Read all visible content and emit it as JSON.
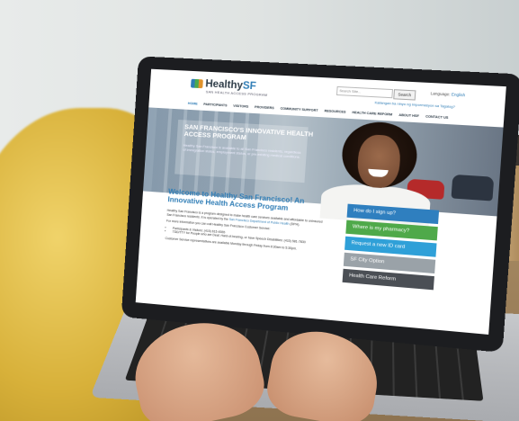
{
  "site": {
    "logo_prefix": "Healthy",
    "logo_suffix": "SF",
    "logo_tagline": "SAN HEALTH ACCESS PROGRAM",
    "search": {
      "placeholder": "Search Site...",
      "button": "Search"
    },
    "language_label": "Language:",
    "language_value": "English",
    "tagalog_link": "Kailangan ba ninyo ng impormasyon sa Tagalog?"
  },
  "nav": [
    "HOME",
    "PARTICIPANTS",
    "VISITORS",
    "PROVIDERS",
    "COMMUNITY SUPPORT",
    "RESOURCES",
    "HEALTH CARE REFORM",
    "ABOUT HSF",
    "CONTACT US"
  ],
  "hero": {
    "title": "SAN FRANCISCO'S INNOVATIVE HEALTH ACCESS PROGRAM",
    "text": "Healthy San Francisco is available to all San Francisco residents, regardless of immigration status, employment status, or pre-existing medical conditions."
  },
  "main": {
    "welcome": "Welcome to Healthy San Francisco! An Innovative Health Access Program",
    "p1": "Healthy San Francisco is a program designed to make health care services available and affordable to uninsured San Francisco residents. It is operated by the",
    "p1_link": "San Francisco Department of Public Health",
    "p1_end": "(DPH).",
    "more_info": "For more information you can call Healthy San Francisco Customer Service:",
    "bullet1": "Participants & Visitors: (415) 615-4555",
    "bullet2": "TDD/TTY for People who are Deaf, Hard-of-hearing, or have Speech Disabilities: (415) 581-7830",
    "hours": "Customer Service representatives are available Monday through Friday from 8:30am to 5:30pm."
  },
  "side_buttons": [
    "How do I sign up?",
    "Where is my pharmacy?",
    "Request a new ID card",
    "SF City Option",
    "Health Care Reform"
  ],
  "colors": {
    "blue": "#2f7fbf",
    "green": "#4fa94a",
    "cyan": "#2fa0d8",
    "gray": "#9aa2a8",
    "dark": "#4b4f55"
  }
}
